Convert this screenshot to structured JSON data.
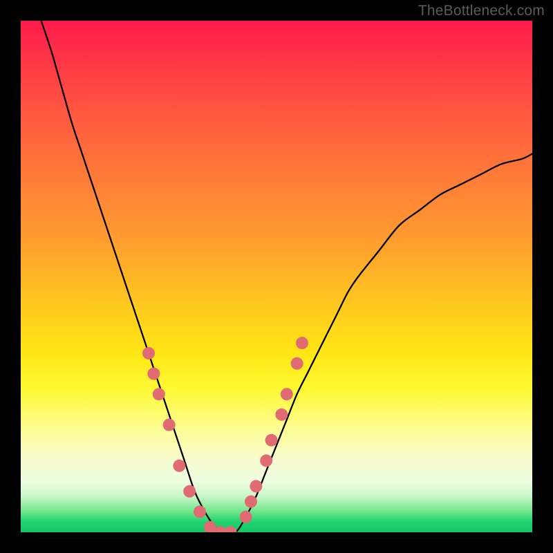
{
  "watermark": "TheBottleneck.com",
  "chart_data": {
    "type": "line",
    "title": "",
    "xlabel": "",
    "ylabel": "",
    "xlim": [
      0,
      100
    ],
    "ylim": [
      0,
      100
    ],
    "grid": false,
    "legend": false,
    "series": [
      {
        "name": "bottleneck-curve",
        "x": [
          4,
          6,
          8,
          10,
          12,
          14,
          16,
          18,
          20,
          22,
          24,
          26,
          28,
          30,
          32,
          34,
          36,
          38,
          40,
          42,
          44,
          46,
          48,
          50,
          52,
          54,
          56,
          58,
          60,
          62,
          64,
          66,
          70,
          74,
          78,
          82,
          86,
          90,
          94,
          98,
          100
        ],
        "y": [
          100,
          94,
          87,
          80,
          74,
          68,
          62,
          56,
          50,
          44,
          38,
          32,
          26,
          20,
          14,
          8,
          4,
          1,
          0,
          0,
          3,
          7,
          12,
          17,
          22,
          27,
          31,
          35,
          39,
          43,
          47,
          50,
          55,
          60,
          63,
          66,
          68,
          70,
          72,
          73,
          74
        ]
      }
    ],
    "markers": {
      "name": "highlight-dots",
      "color": "#e06b72",
      "radius_px": 9,
      "points": [
        {
          "x": 25,
          "y": 35
        },
        {
          "x": 26,
          "y": 31
        },
        {
          "x": 27,
          "y": 27
        },
        {
          "x": 29,
          "y": 21
        },
        {
          "x": 31,
          "y": 13
        },
        {
          "x": 33,
          "y": 8
        },
        {
          "x": 35,
          "y": 4
        },
        {
          "x": 37,
          "y": 1
        },
        {
          "x": 39,
          "y": 0
        },
        {
          "x": 41,
          "y": 0
        },
        {
          "x": 44,
          "y": 3
        },
        {
          "x": 45,
          "y": 6
        },
        {
          "x": 46,
          "y": 9
        },
        {
          "x": 48,
          "y": 14
        },
        {
          "x": 49,
          "y": 18
        },
        {
          "x": 51,
          "y": 23
        },
        {
          "x": 52,
          "y": 27
        },
        {
          "x": 54,
          "y": 33
        },
        {
          "x": 55,
          "y": 37
        }
      ]
    },
    "background": {
      "type": "vertical-gradient",
      "stops": [
        {
          "pos": 0.0,
          "color": "#ff1a4d"
        },
        {
          "pos": 0.3,
          "color": "#ff7a38"
        },
        {
          "pos": 0.55,
          "color": "#ffc61f"
        },
        {
          "pos": 0.72,
          "color": "#fff933"
        },
        {
          "pos": 0.9,
          "color": "#eefde0"
        },
        {
          "pos": 1.0,
          "color": "#16c864"
        }
      ]
    }
  }
}
